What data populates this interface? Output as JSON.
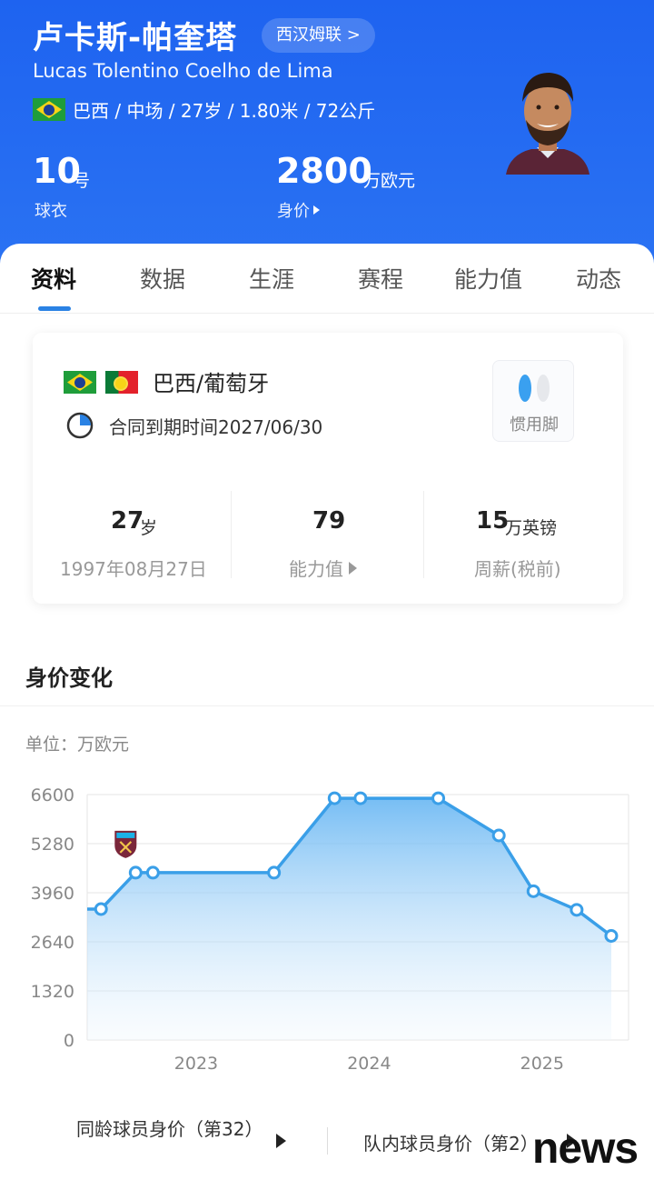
{
  "header": {
    "name_cn": "卢卡斯-帕奎塔",
    "league_button": "西汉姆联 >",
    "name_en": "Lucas Tolentino Coelho de Lima",
    "meta": "巴西 / 中场 / 27岁 / 1.80米 / 72公斤",
    "shirt_number": "10",
    "shirt_unit": "号",
    "shirt_label": "球衣",
    "value_number": "2800",
    "value_unit": "万欧元",
    "value_label": "身价"
  },
  "tabs": [
    "资料",
    "数据",
    "生涯",
    "赛程",
    "能力值",
    "动态"
  ],
  "info_card": {
    "nationality": "巴西/葡萄牙",
    "contract": "合同到期时间2027/06/30",
    "foot_label": "惯用脚",
    "age_number": "27",
    "age_unit": "岁",
    "birth_date": "1997年08月27日",
    "ability_number": "79",
    "ability_label": "能力值",
    "wage_number": "15",
    "wage_unit": "万英镑",
    "wage_label": "周薪(税前)"
  },
  "value_section": {
    "title": "身价变化",
    "unit_label": "单位：万欧元"
  },
  "chart_data": {
    "type": "area",
    "x": [
      2022.45,
      2022.65,
      2022.75,
      2023.45,
      2023.8,
      2023.95,
      2024.4,
      2024.75,
      2024.95,
      2025.2,
      2025.4
    ],
    "values": [
      3520,
      4500,
      4500,
      4500,
      6500,
      6500,
      6500,
      5500,
      4000,
      3500,
      2800
    ],
    "start_value": 3520,
    "yticks": [
      0,
      1320,
      2640,
      3960,
      5280,
      6600
    ],
    "xticks": [
      "2023",
      "2024",
      "2025"
    ],
    "xlim": [
      2022.37,
      2025.5
    ],
    "ylim": [
      0,
      6600
    ],
    "grid": true,
    "club_badge_at_x": 2022.65,
    "line_color": "#3a9fe8"
  },
  "bottom": {
    "age_peer_value": "同龄球员身价（第32）",
    "team_value": "队内球员身价（第2）"
  },
  "watermark": "news",
  "colors": {
    "header_bg": "#1e63f0",
    "accent": "#2a82e4"
  }
}
